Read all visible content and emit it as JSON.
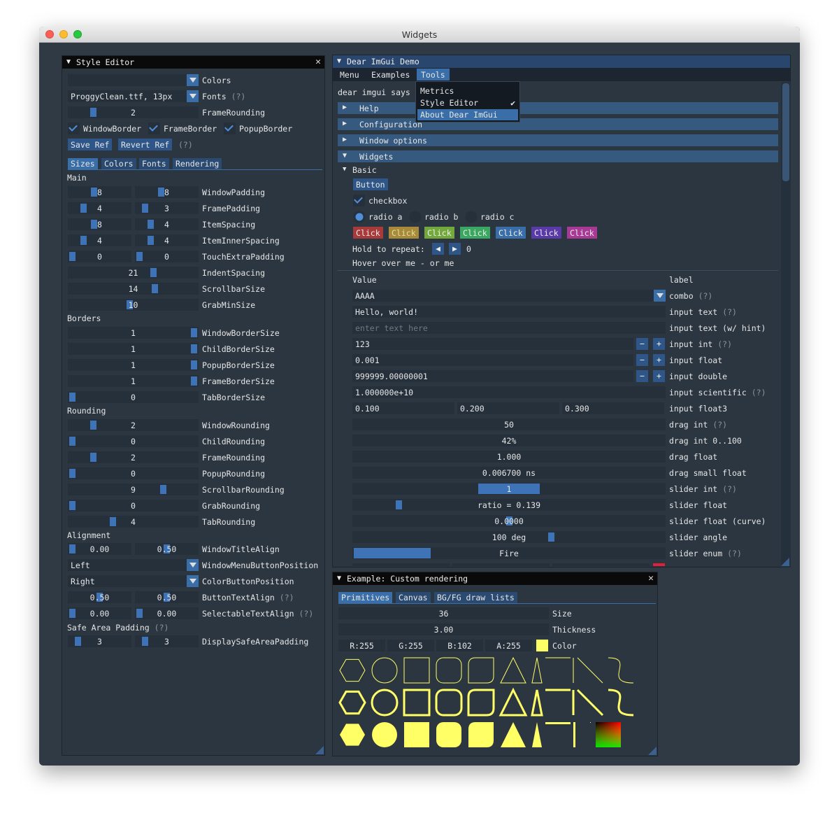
{
  "app": {
    "title": "Widgets"
  },
  "style_editor": {
    "title": "Style Editor",
    "colors_label": "Colors",
    "font_value": "ProggyClean.ttf, 13px",
    "fonts_label": "Fonts",
    "help": "(?)",
    "frame_rounding_value": "2",
    "frame_rounding_label": "FrameRounding",
    "window_border": "WindowBorder",
    "frame_border": "FrameBorder",
    "popup_border": "PopupBorder",
    "save_ref": "Save Ref",
    "revert_ref": "Revert Ref",
    "tabs": [
      "Sizes",
      "Colors",
      "Fonts",
      "Rendering"
    ],
    "main_section": "Main",
    "borders_section": "Borders",
    "rounding_section": "Rounding",
    "alignment_section": "Alignment",
    "main_rows": [
      {
        "v1": "8",
        "v2": "8",
        "label": "WindowPadding"
      },
      {
        "v1": "4",
        "v2": "3",
        "label": "FramePadding"
      },
      {
        "v1": "8",
        "v2": "4",
        "label": "ItemSpacing"
      },
      {
        "v1": "4",
        "v2": "4",
        "label": "ItemInnerSpacing"
      },
      {
        "v1": "0",
        "v2": "0",
        "label": "TouchExtraPadding"
      },
      {
        "v1": "21",
        "label": "IndentSpacing"
      },
      {
        "v1": "14",
        "label": "ScrollbarSize"
      },
      {
        "v1": "10",
        "label": "GrabMinSize"
      }
    ],
    "border_rows": [
      {
        "v1": "1",
        "label": "WindowBorderSize"
      },
      {
        "v1": "1",
        "label": "ChildBorderSize"
      },
      {
        "v1": "1",
        "label": "PopupBorderSize"
      },
      {
        "v1": "1",
        "label": "FrameBorderSize"
      },
      {
        "v1": "0",
        "label": "TabBorderSize"
      }
    ],
    "rounding_rows": [
      {
        "v1": "2",
        "label": "WindowRounding"
      },
      {
        "v1": "0",
        "label": "ChildRounding"
      },
      {
        "v1": "2",
        "label": "FrameRounding"
      },
      {
        "v1": "0",
        "label": "PopupRounding"
      },
      {
        "v1": "9",
        "label": "ScrollbarRounding"
      },
      {
        "v1": "0",
        "label": "GrabRounding"
      },
      {
        "v1": "4",
        "label": "TabRounding"
      }
    ],
    "window_title_align": {
      "v1": "0.00",
      "v2": "0.50",
      "label": "WindowTitleAlign"
    },
    "window_menu_button_position": {
      "value": "Left",
      "label": "WindowMenuButtonPosition"
    },
    "color_button_position": {
      "value": "Right",
      "label": "ColorButtonPosition"
    },
    "button_text_align": {
      "v1": "0.50",
      "v2": "0.50",
      "label": "ButtonTextAlign"
    },
    "selectable_text_align": {
      "v1": "0.00",
      "v2": "0.00",
      "label": "SelectableTextAlign"
    },
    "safe_area_label": "Safe Area Padding",
    "display_safe_area": {
      "v1": "3",
      "v2": "3",
      "label": "DisplaySafeAreaPadding"
    }
  },
  "demo": {
    "title": "Dear ImGui Demo",
    "menubar": [
      "Menu",
      "Examples",
      "Tools"
    ],
    "tools_menu": [
      "Metrics",
      "Style Editor",
      "About Dear ImGui"
    ],
    "says_text": "dear imgui says",
    "headers": [
      "Help",
      "Configuration",
      "Window options",
      "Widgets"
    ],
    "basic_node": "Basic",
    "button_label": "Button",
    "checkbox_label": "checkbox",
    "radios": [
      "radio a",
      "radio b",
      "radio c"
    ],
    "click_label": "Click",
    "click_colors": [
      {
        "bg": "#a83a3a",
        "fg": "#eeeeee"
      },
      {
        "bg": "#a88a3a",
        "fg": "#e0e0a0"
      },
      {
        "bg": "#73a83a",
        "fg": "#eeeeee"
      },
      {
        "bg": "#3aa860",
        "fg": "#eeeeee"
      },
      {
        "bg": "#3a6ea8",
        "fg": "#eeeeee"
      },
      {
        "bg": "#5a3aa8",
        "fg": "#eeeeee"
      },
      {
        "bg": "#a83a96",
        "fg": "#eeeeee"
      }
    ],
    "hold_label": "Hold to repeat:",
    "hold_count": "0",
    "hover_text": "Hover over me - or me",
    "value_header": "Value",
    "label_header": "label",
    "combo_value": "AAAA",
    "combo_label": "combo",
    "input_text_value": "Hello, world!",
    "input_text_label": "input text",
    "hint_placeholder": "enter text here",
    "hint_label": "input text (w/ hint)",
    "input_int_value": "123",
    "input_int_label": "input int",
    "input_float_value": "0.001",
    "input_float_label": "input float",
    "input_double_value": "999999.00000001",
    "input_double_label": "input double",
    "input_sci_value": "1.000000e+10",
    "input_sci_label": "input scientific",
    "float3": [
      "0.100",
      "0.200",
      "0.300"
    ],
    "float3_label": "input float3",
    "drag_int_value": "50",
    "drag_int_label": "drag int",
    "drag_pct_value": "42%",
    "drag_pct_label": "drag int 0..100",
    "drag_float_value": "1.000",
    "drag_float_label": "drag float",
    "drag_small_value": "0.006700 ns",
    "drag_small_label": "drag small float",
    "slider_int_value": "1",
    "slider_int_label": "slider int",
    "slider_float_value": "ratio = 0.139",
    "slider_float_label": "slider float",
    "slider_curve_value": "0.0000",
    "slider_curve_label": "slider float (curve)",
    "slider_angle_value": "100 deg",
    "slider_angle_label": "slider angle",
    "slider_enum_value": "Fire",
    "slider_enum_label": "slider enum"
  },
  "custom": {
    "title": "Example: Custom rendering",
    "tabs": [
      "Primitives",
      "Canvas",
      "BG/FG draw lists"
    ],
    "size_value": "36",
    "size_label": "Size",
    "thickness_value": "3.00",
    "thickness_label": "Thickness",
    "r": "R:255",
    "g": "G:255",
    "b": "B:102",
    "a": "A:255",
    "color_label": "Color",
    "swatch_color": "#ffff66"
  },
  "colors": {
    "accent": "#3a6ea8",
    "bg": "#2c3640",
    "shape": "#ffff66"
  }
}
